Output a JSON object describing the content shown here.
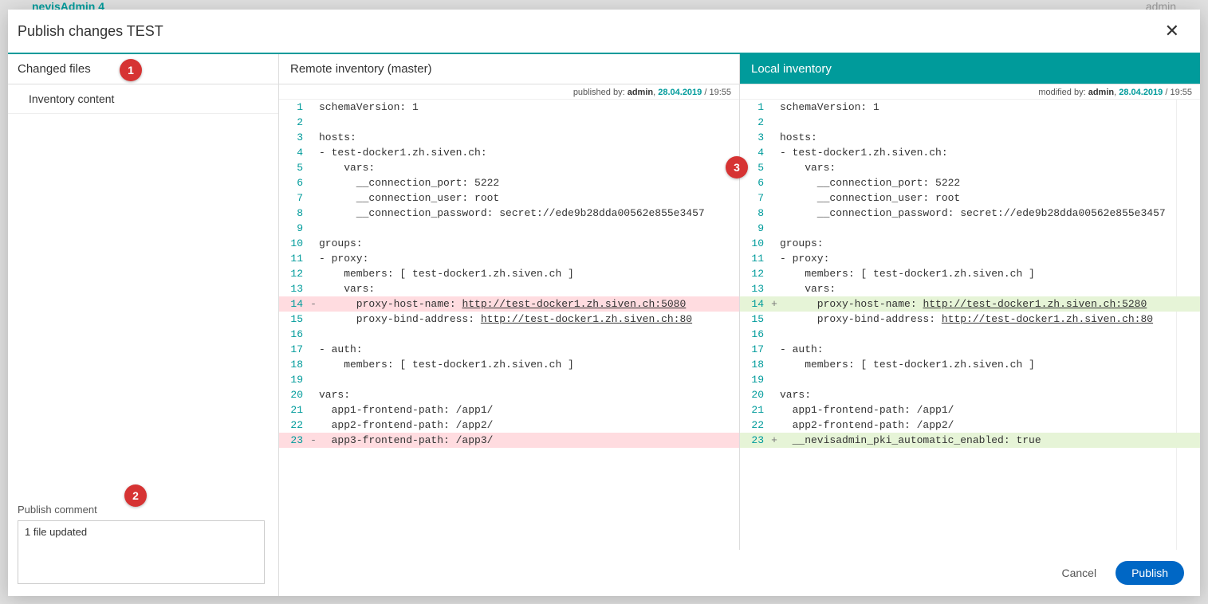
{
  "bg": {
    "brand": "nevisAdmin 4",
    "user": "admin"
  },
  "modal": {
    "title": "Publish changes TEST",
    "close": "✕"
  },
  "sidebar": {
    "header": "Changed files",
    "item": "Inventory content"
  },
  "commentSection": {
    "label": "Publish comment",
    "value": "1 file updated"
  },
  "badges": {
    "b1": "1",
    "b2": "2",
    "b3": "3"
  },
  "remote": {
    "title": "Remote inventory (master)",
    "sub_prefix": "published by: ",
    "author": "admin",
    "date": "28.04.2019",
    "time": " / 19:55",
    "lines": [
      {
        "n": "1",
        "s": "",
        "c": "schemaVersion: 1",
        "t": ""
      },
      {
        "n": "2",
        "s": "",
        "c": "",
        "t": ""
      },
      {
        "n": "3",
        "s": "",
        "c": "hosts:",
        "t": ""
      },
      {
        "n": "4",
        "s": "",
        "c": "- test-docker1.zh.siven.ch:",
        "t": ""
      },
      {
        "n": "5",
        "s": "",
        "c": "    vars:",
        "t": ""
      },
      {
        "n": "6",
        "s": "",
        "c": "      __connection_port: 5222",
        "t": ""
      },
      {
        "n": "7",
        "s": "",
        "c": "      __connection_user: root",
        "t": ""
      },
      {
        "n": "8",
        "s": "",
        "c": "      __connection_password: secret://ede9b28dda00562e855e3457",
        "t": ""
      },
      {
        "n": "9",
        "s": "",
        "c": "",
        "t": ""
      },
      {
        "n": "10",
        "s": "",
        "c": "groups:",
        "t": ""
      },
      {
        "n": "11",
        "s": "",
        "c": "- proxy:",
        "t": ""
      },
      {
        "n": "12",
        "s": "",
        "c": "    members: [ test-docker1.zh.siven.ch ]",
        "t": ""
      },
      {
        "n": "13",
        "s": "",
        "c": "    vars:",
        "t": ""
      },
      {
        "n": "14",
        "s": "-",
        "c": "      proxy-host-name: ",
        "link": "http://test-docker1.zh.siven.ch:5080",
        "t": "del"
      },
      {
        "n": "15",
        "s": "",
        "c": "      proxy-bind-address: ",
        "link": "http://test-docker1.zh.siven.ch:80",
        "t": ""
      },
      {
        "n": "16",
        "s": "",
        "c": "",
        "t": ""
      },
      {
        "n": "17",
        "s": "",
        "c": "- auth:",
        "t": ""
      },
      {
        "n": "18",
        "s": "",
        "c": "    members: [ test-docker1.zh.siven.ch ]",
        "t": ""
      },
      {
        "n": "19",
        "s": "",
        "c": "",
        "t": ""
      },
      {
        "n": "20",
        "s": "",
        "c": "vars:",
        "t": ""
      },
      {
        "n": "21",
        "s": "",
        "c": "  app1-frontend-path: /app1/",
        "t": ""
      },
      {
        "n": "22",
        "s": "",
        "c": "  app2-frontend-path: /app2/",
        "t": ""
      },
      {
        "n": "23",
        "s": "-",
        "c": "  app3-frontend-path: /app3/",
        "t": "del"
      }
    ]
  },
  "local": {
    "title": "Local inventory",
    "sub_prefix": "modified by: ",
    "author": "admin",
    "date": "28.04.2019",
    "time": " / 19:55",
    "lines": [
      {
        "n": "1",
        "s": "",
        "c": "schemaVersion: 1",
        "t": ""
      },
      {
        "n": "2",
        "s": "",
        "c": "",
        "t": ""
      },
      {
        "n": "3",
        "s": "",
        "c": "hosts:",
        "t": ""
      },
      {
        "n": "4",
        "s": "",
        "c": "- test-docker1.zh.siven.ch:",
        "t": ""
      },
      {
        "n": "5",
        "s": "",
        "c": "    vars:",
        "t": ""
      },
      {
        "n": "6",
        "s": "",
        "c": "      __connection_port: 5222",
        "t": ""
      },
      {
        "n": "7",
        "s": "",
        "c": "      __connection_user: root",
        "t": ""
      },
      {
        "n": "8",
        "s": "",
        "c": "      __connection_password: secret://ede9b28dda00562e855e3457",
        "t": ""
      },
      {
        "n": "9",
        "s": "",
        "c": "",
        "t": ""
      },
      {
        "n": "10",
        "s": "",
        "c": "groups:",
        "t": ""
      },
      {
        "n": "11",
        "s": "",
        "c": "- proxy:",
        "t": ""
      },
      {
        "n": "12",
        "s": "",
        "c": "    members: [ test-docker1.zh.siven.ch ]",
        "t": ""
      },
      {
        "n": "13",
        "s": "",
        "c": "    vars:",
        "t": ""
      },
      {
        "n": "14",
        "s": "+",
        "c": "      proxy-host-name: ",
        "link": "http://test-docker1.zh.siven.ch:5280",
        "t": "add"
      },
      {
        "n": "15",
        "s": "",
        "c": "      proxy-bind-address: ",
        "link": "http://test-docker1.zh.siven.ch:80",
        "t": ""
      },
      {
        "n": "16",
        "s": "",
        "c": "",
        "t": ""
      },
      {
        "n": "17",
        "s": "",
        "c": "- auth:",
        "t": ""
      },
      {
        "n": "18",
        "s": "",
        "c": "    members: [ test-docker1.zh.siven.ch ]",
        "t": ""
      },
      {
        "n": "19",
        "s": "",
        "c": "",
        "t": ""
      },
      {
        "n": "20",
        "s": "",
        "c": "vars:",
        "t": ""
      },
      {
        "n": "21",
        "s": "",
        "c": "  app1-frontend-path: /app1/",
        "t": ""
      },
      {
        "n": "22",
        "s": "",
        "c": "  app2-frontend-path: /app2/",
        "t": ""
      },
      {
        "n": "23",
        "s": "+",
        "c": "  __nevisadmin_pki_automatic_enabled: true",
        "t": "add"
      }
    ]
  },
  "footer": {
    "cancel": "Cancel",
    "publish": "Publish"
  }
}
